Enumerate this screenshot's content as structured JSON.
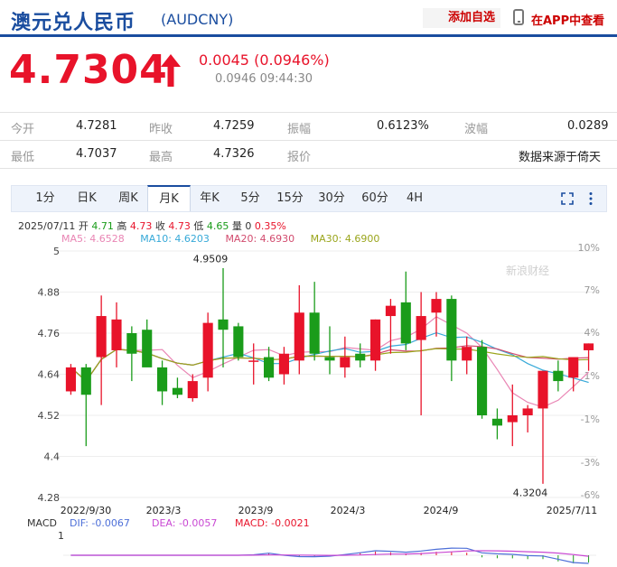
{
  "header": {
    "name": "澳元兑人民币",
    "code": "(AUDCNY)",
    "add_label": "添加自选",
    "app_label": "在APP中查看"
  },
  "quote": {
    "price": "4.7304",
    "change": "0.0045 (0.0946%)",
    "sub": "0.0946 09:44:30",
    "color_up": "#e8132a"
  },
  "stats": {
    "row1": [
      {
        "label": "今开",
        "value": "4.7281"
      },
      {
        "label": "昨收",
        "value": "4.7259"
      },
      {
        "label": "振幅",
        "value": "0.6123%"
      },
      {
        "label": "波幅",
        "value": "0.0289"
      }
    ],
    "row2": [
      {
        "label": "最低",
        "value": "4.7037"
      },
      {
        "label": "最高",
        "value": "4.7326"
      },
      {
        "label": "报价",
        "value": ""
      },
      {
        "label": "",
        "value": "数据来源于倚天"
      }
    ]
  },
  "tabs": [
    "1分",
    "日K",
    "周K",
    "月K",
    "年K",
    "5分",
    "15分",
    "30分",
    "60分",
    "4H"
  ],
  "active_tab": "月K",
  "chart_info": {
    "date": "2025/07/11",
    "open_label": "开",
    "open": "4.71",
    "high_label": "高",
    "high": "4.73",
    "close_label": "收",
    "close": "4.73",
    "low_label": "低",
    "low": "4.65",
    "vol_label": "量",
    "vol": "0",
    "pct": "0.35%"
  },
  "ma_legend": {
    "ma5": "MA5: 4.6528",
    "ma10": "MA10: 4.6203",
    "ma20": "MA20: 4.6930",
    "ma30": "MA30: 4.6900"
  },
  "macd_legend": {
    "label": "MACD",
    "dif": "DIF: -0.0067",
    "dea": "DEA: -0.0057",
    "macd": "MACD: -0.0021"
  },
  "watermark": "新浪财经",
  "colors": {
    "up": "#e8132a",
    "down": "#1a9c1a",
    "ma5": "#e985b4",
    "ma10": "#36a9d8",
    "ma20": "#d24b6e",
    "ma30": "#9aa51c"
  },
  "chart_data": {
    "type": "candlestick",
    "y_ticks": [
      "5",
      "4.88",
      "4.76",
      "4.64",
      "4.52",
      "4.4",
      "4.28"
    ],
    "y_range": [
      4.28,
      5.0
    ],
    "pct_ticks": [
      "10%",
      "7%",
      "4%",
      "1%",
      "-1%",
      "-3%",
      "-6%"
    ],
    "x_labels": [
      "2022/9/30",
      "2023/3",
      "2023/9",
      "2024/3",
      "2024/9",
      "2025/7/11"
    ],
    "annotations": [
      {
        "label": "4.9509",
        "value": 4.9509
      },
      {
        "label": "4.3204",
        "value": 4.3204
      }
    ],
    "candles": [
      {
        "o": 4.59,
        "h": 4.67,
        "l": 4.58,
        "c": 4.66
      },
      {
        "o": 4.66,
        "h": 4.67,
        "l": 4.43,
        "c": 4.58
      },
      {
        "o": 4.69,
        "h": 4.87,
        "l": 4.55,
        "c": 4.81
      },
      {
        "o": 4.71,
        "h": 4.85,
        "l": 4.66,
        "c": 4.8
      },
      {
        "o": 4.76,
        "h": 4.78,
        "l": 4.62,
        "c": 4.7
      },
      {
        "o": 4.77,
        "h": 4.8,
        "l": 4.67,
        "c": 4.66
      },
      {
        "o": 4.66,
        "h": 4.68,
        "l": 4.55,
        "c": 4.59
      },
      {
        "o": 4.6,
        "h": 4.63,
        "l": 4.57,
        "c": 4.58
      },
      {
        "o": 4.57,
        "h": 4.64,
        "l": 4.56,
        "c": 4.62
      },
      {
        "o": 4.63,
        "h": 4.82,
        "l": 4.59,
        "c": 4.79
      },
      {
        "o": 4.8,
        "h": 4.95,
        "l": 4.66,
        "c": 4.77
      },
      {
        "o": 4.78,
        "h": 4.79,
        "l": 4.68,
        "c": 4.69
      },
      {
        "o": 4.68,
        "h": 4.73,
        "l": 4.61,
        "c": 4.68
      },
      {
        "o": 4.69,
        "h": 4.72,
        "l": 4.62,
        "c": 4.63
      },
      {
        "o": 4.64,
        "h": 4.72,
        "l": 4.61,
        "c": 4.7
      },
      {
        "o": 4.68,
        "h": 4.9,
        "l": 4.64,
        "c": 4.82
      },
      {
        "o": 4.82,
        "h": 4.91,
        "l": 4.68,
        "c": 4.7
      },
      {
        "o": 4.69,
        "h": 4.78,
        "l": 4.64,
        "c": 4.68
      },
      {
        "o": 4.66,
        "h": 4.75,
        "l": 4.63,
        "c": 4.69
      },
      {
        "o": 4.7,
        "h": 4.73,
        "l": 4.66,
        "c": 4.68
      },
      {
        "o": 4.68,
        "h": 4.8,
        "l": 4.65,
        "c": 4.8
      },
      {
        "o": 4.81,
        "h": 4.86,
        "l": 4.7,
        "c": 4.84
      },
      {
        "o": 4.85,
        "h": 4.94,
        "l": 4.71,
        "c": 4.73
      },
      {
        "o": 4.74,
        "h": 4.88,
        "l": 4.52,
        "c": 4.81
      },
      {
        "o": 4.82,
        "h": 4.88,
        "l": 4.75,
        "c": 4.86
      },
      {
        "o": 4.86,
        "h": 4.87,
        "l": 4.62,
        "c": 4.68
      },
      {
        "o": 4.68,
        "h": 4.75,
        "l": 4.64,
        "c": 4.72
      },
      {
        "o": 4.72,
        "h": 4.74,
        "l": 4.51,
        "c": 4.52
      },
      {
        "o": 4.51,
        "h": 4.54,
        "l": 4.45,
        "c": 4.49
      },
      {
        "o": 4.5,
        "h": 4.61,
        "l": 4.43,
        "c": 4.52
      },
      {
        "o": 4.52,
        "h": 4.55,
        "l": 4.47,
        "c": 4.54
      },
      {
        "o": 4.54,
        "h": 4.65,
        "l": 4.32,
        "c": 4.65
      },
      {
        "o": 4.65,
        "h": 4.68,
        "l": 4.59,
        "c": 4.62
      },
      {
        "o": 4.63,
        "h": 4.68,
        "l": 4.59,
        "c": 4.69
      },
      {
        "o": 4.71,
        "h": 4.73,
        "l": 4.65,
        "c": 4.73
      }
    ]
  }
}
